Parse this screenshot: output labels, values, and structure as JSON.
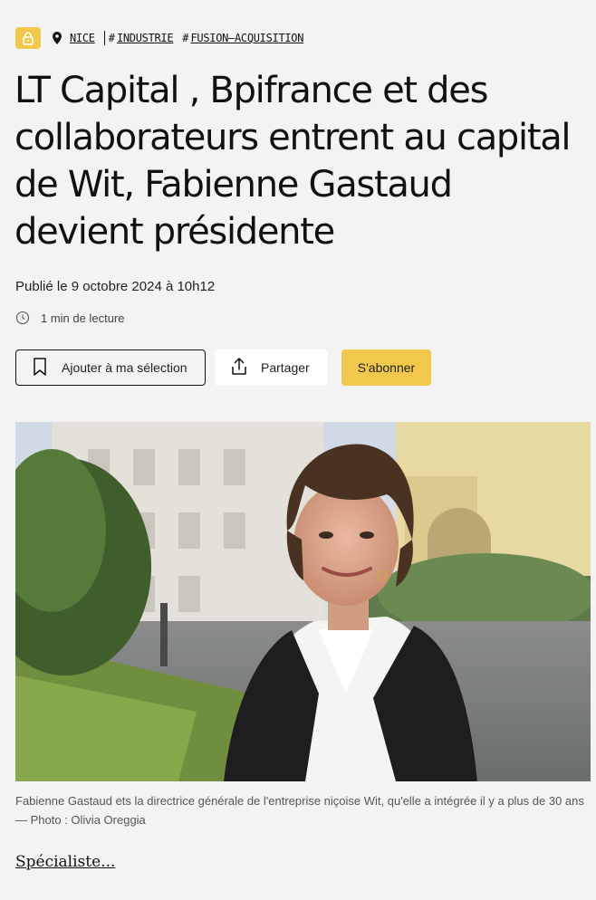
{
  "tags": {
    "lock_icon": "lock-icon",
    "location_icon": "map-pin-icon",
    "location": "NICE",
    "hash_symbol": "#",
    "items": [
      "INDUSTRIE",
      "FUSION–ACQUISITION"
    ]
  },
  "article": {
    "title": "LT Capital , Bpifrance et des collaborateurs entrent au capital de Wit, Fabienne Gastaud devient présidente",
    "published": "Publié le 9 octobre 2024 à 10h12",
    "read_time": "1 min de lecture",
    "photo_caption": "Fabienne Gastaud ets la directrice générale de l'entreprise niçoise Wit, qu'elle a intégrée il y a plus de 30 ans — Photo : Olivia Oreggia",
    "more_link": "Spécialiste..."
  },
  "actions": {
    "save_label": "Ajouter à ma sélection",
    "share_label": "Partager",
    "subscribe_label": "S'abonner"
  },
  "colors": {
    "accent": "#f1c84b",
    "background": "#f3f3f3",
    "text": "#111111"
  }
}
